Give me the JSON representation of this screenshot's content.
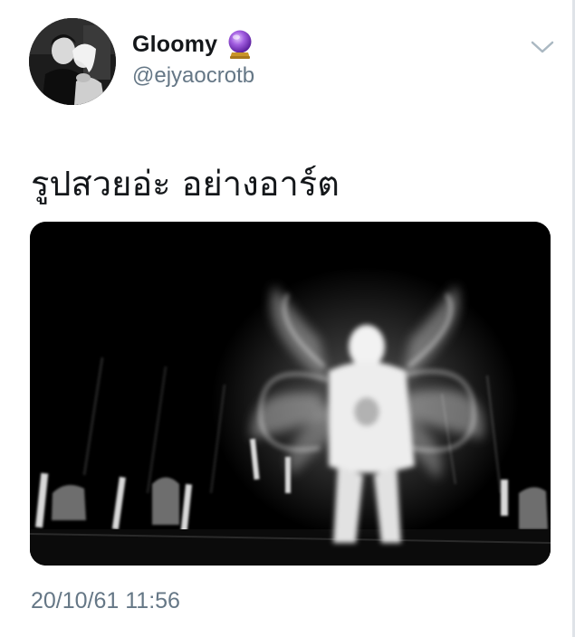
{
  "tweet": {
    "author": {
      "display_name": "Gloomy",
      "badge_emoji": "crystal-ball-icon",
      "handle": "@ejyaocrotb"
    },
    "text": "รูปสวยอ่ะ อย่างอาร์ต",
    "timestamp": "20/10/61 11:56"
  },
  "colors": {
    "name": "#14171a",
    "secondary": "#657786",
    "background": "#ffffff",
    "crystal_ball": "#9b59d0"
  }
}
